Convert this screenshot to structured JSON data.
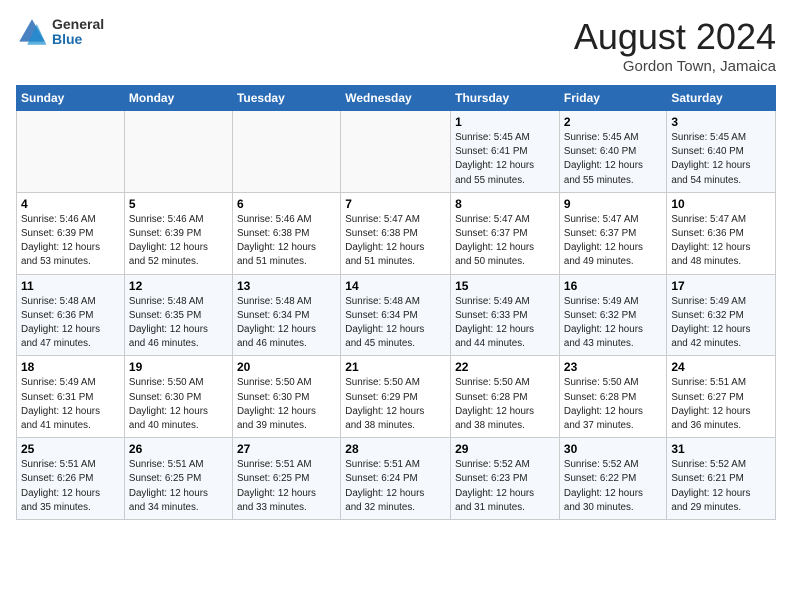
{
  "header": {
    "logo_general": "General",
    "logo_blue": "Blue",
    "cal_title": "August 2024",
    "cal_subtitle": "Gordon Town, Jamaica"
  },
  "days_of_week": [
    "Sunday",
    "Monday",
    "Tuesday",
    "Wednesday",
    "Thursday",
    "Friday",
    "Saturday"
  ],
  "weeks": [
    [
      {
        "day": "",
        "info": ""
      },
      {
        "day": "",
        "info": ""
      },
      {
        "day": "",
        "info": ""
      },
      {
        "day": "",
        "info": ""
      },
      {
        "day": "1",
        "info": "Sunrise: 5:45 AM\nSunset: 6:41 PM\nDaylight: 12 hours\nand 55 minutes."
      },
      {
        "day": "2",
        "info": "Sunrise: 5:45 AM\nSunset: 6:40 PM\nDaylight: 12 hours\nand 55 minutes."
      },
      {
        "day": "3",
        "info": "Sunrise: 5:45 AM\nSunset: 6:40 PM\nDaylight: 12 hours\nand 54 minutes."
      }
    ],
    [
      {
        "day": "4",
        "info": "Sunrise: 5:46 AM\nSunset: 6:39 PM\nDaylight: 12 hours\nand 53 minutes."
      },
      {
        "day": "5",
        "info": "Sunrise: 5:46 AM\nSunset: 6:39 PM\nDaylight: 12 hours\nand 52 minutes."
      },
      {
        "day": "6",
        "info": "Sunrise: 5:46 AM\nSunset: 6:38 PM\nDaylight: 12 hours\nand 51 minutes."
      },
      {
        "day": "7",
        "info": "Sunrise: 5:47 AM\nSunset: 6:38 PM\nDaylight: 12 hours\nand 51 minutes."
      },
      {
        "day": "8",
        "info": "Sunrise: 5:47 AM\nSunset: 6:37 PM\nDaylight: 12 hours\nand 50 minutes."
      },
      {
        "day": "9",
        "info": "Sunrise: 5:47 AM\nSunset: 6:37 PM\nDaylight: 12 hours\nand 49 minutes."
      },
      {
        "day": "10",
        "info": "Sunrise: 5:47 AM\nSunset: 6:36 PM\nDaylight: 12 hours\nand 48 minutes."
      }
    ],
    [
      {
        "day": "11",
        "info": "Sunrise: 5:48 AM\nSunset: 6:36 PM\nDaylight: 12 hours\nand 47 minutes."
      },
      {
        "day": "12",
        "info": "Sunrise: 5:48 AM\nSunset: 6:35 PM\nDaylight: 12 hours\nand 46 minutes."
      },
      {
        "day": "13",
        "info": "Sunrise: 5:48 AM\nSunset: 6:34 PM\nDaylight: 12 hours\nand 46 minutes."
      },
      {
        "day": "14",
        "info": "Sunrise: 5:48 AM\nSunset: 6:34 PM\nDaylight: 12 hours\nand 45 minutes."
      },
      {
        "day": "15",
        "info": "Sunrise: 5:49 AM\nSunset: 6:33 PM\nDaylight: 12 hours\nand 44 minutes."
      },
      {
        "day": "16",
        "info": "Sunrise: 5:49 AM\nSunset: 6:32 PM\nDaylight: 12 hours\nand 43 minutes."
      },
      {
        "day": "17",
        "info": "Sunrise: 5:49 AM\nSunset: 6:32 PM\nDaylight: 12 hours\nand 42 minutes."
      }
    ],
    [
      {
        "day": "18",
        "info": "Sunrise: 5:49 AM\nSunset: 6:31 PM\nDaylight: 12 hours\nand 41 minutes."
      },
      {
        "day": "19",
        "info": "Sunrise: 5:50 AM\nSunset: 6:30 PM\nDaylight: 12 hours\nand 40 minutes."
      },
      {
        "day": "20",
        "info": "Sunrise: 5:50 AM\nSunset: 6:30 PM\nDaylight: 12 hours\nand 39 minutes."
      },
      {
        "day": "21",
        "info": "Sunrise: 5:50 AM\nSunset: 6:29 PM\nDaylight: 12 hours\nand 38 minutes."
      },
      {
        "day": "22",
        "info": "Sunrise: 5:50 AM\nSunset: 6:28 PM\nDaylight: 12 hours\nand 38 minutes."
      },
      {
        "day": "23",
        "info": "Sunrise: 5:50 AM\nSunset: 6:28 PM\nDaylight: 12 hours\nand 37 minutes."
      },
      {
        "day": "24",
        "info": "Sunrise: 5:51 AM\nSunset: 6:27 PM\nDaylight: 12 hours\nand 36 minutes."
      }
    ],
    [
      {
        "day": "25",
        "info": "Sunrise: 5:51 AM\nSunset: 6:26 PM\nDaylight: 12 hours\nand 35 minutes."
      },
      {
        "day": "26",
        "info": "Sunrise: 5:51 AM\nSunset: 6:25 PM\nDaylight: 12 hours\nand 34 minutes."
      },
      {
        "day": "27",
        "info": "Sunrise: 5:51 AM\nSunset: 6:25 PM\nDaylight: 12 hours\nand 33 minutes."
      },
      {
        "day": "28",
        "info": "Sunrise: 5:51 AM\nSunset: 6:24 PM\nDaylight: 12 hours\nand 32 minutes."
      },
      {
        "day": "29",
        "info": "Sunrise: 5:52 AM\nSunset: 6:23 PM\nDaylight: 12 hours\nand 31 minutes."
      },
      {
        "day": "30",
        "info": "Sunrise: 5:52 AM\nSunset: 6:22 PM\nDaylight: 12 hours\nand 30 minutes."
      },
      {
        "day": "31",
        "info": "Sunrise: 5:52 AM\nSunset: 6:21 PM\nDaylight: 12 hours\nand 29 minutes."
      }
    ]
  ]
}
